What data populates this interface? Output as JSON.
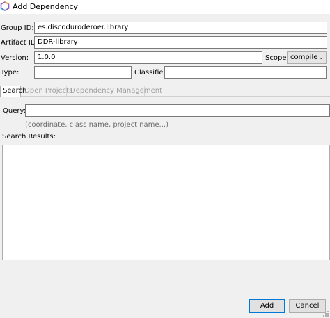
{
  "window": {
    "title": "Add Dependency"
  },
  "form": {
    "group_id_label": "Group ID:",
    "group_id_value": "es.discoduroderoer.library",
    "artifact_id_label": "Artifact ID:",
    "artifact_id_value": "DDR-library",
    "version_label": "Version:",
    "version_value": "1.0.0",
    "scope_label": "Scope:",
    "scope_value": "compile",
    "type_label": "Type:",
    "type_value": "",
    "classifier_label": "Classifier:",
    "classifier_value": ""
  },
  "tabs": [
    {
      "label": "Search",
      "active": true
    },
    {
      "label": "Open Projects",
      "active": false
    },
    {
      "label": "Dependency Management",
      "active": false
    }
  ],
  "search": {
    "query_label": "Query:",
    "query_value": "",
    "hint": "(coordinate, class name, project name...)",
    "results_label": "Search Results:"
  },
  "buttons": {
    "add": "Add",
    "cancel": "Cancel"
  },
  "icons": {
    "app": "netbeans-hexagon-icon",
    "scope_dropdown": "chevron-down-icon"
  },
  "colors": {
    "accent_focus": "#0078d7",
    "icon_orange": "#f0a030",
    "icon_purple": "#8a5cc7",
    "icon_blue": "#3b8fd8"
  }
}
